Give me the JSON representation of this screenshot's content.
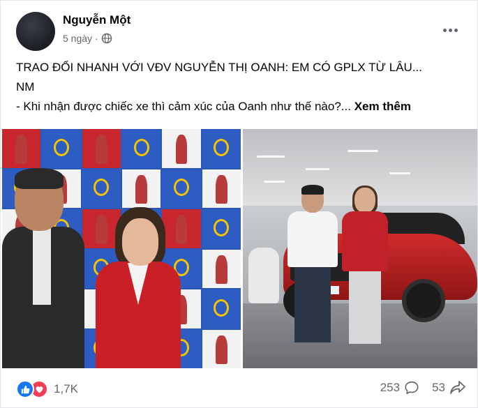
{
  "post": {
    "author": "Nguyễn Một",
    "time": "5 ngày",
    "audience_icon": "globe-icon",
    "more_icon": "more-horizontal-icon",
    "text_lines": [
      "TRAO ĐỔI NHANH VỚI VĐV NGUYỄN THỊ OANH: EM CÓ GPLX TỪ LÂU...",
      "NM",
      "- Khi nhận được chiếc xe thì cảm xúc của Oanh như thế nào?..."
    ],
    "see_more": "Xem thêm",
    "images": {
      "left": {
        "plate_text": ""
      },
      "right": {
        "plate_text": "2008"
      }
    }
  },
  "footer": {
    "reaction_icons": [
      "like-icon",
      "love-icon"
    ],
    "reaction_count": "1,7K",
    "comment_count": "253",
    "share_count": "53",
    "colors": {
      "like": "#1877f2",
      "love": "#f33e58"
    }
  }
}
